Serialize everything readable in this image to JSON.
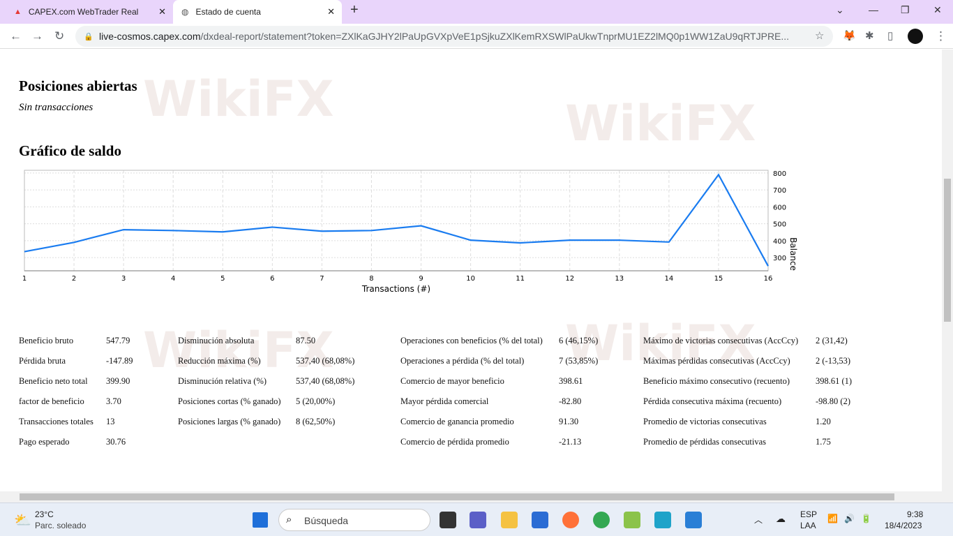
{
  "browser": {
    "tabs": [
      {
        "title": "CAPEX.com WebTrader Real",
        "active": false
      },
      {
        "title": "Estado de cuenta",
        "active": true
      }
    ],
    "url_host": "live-cosmos.capex.com",
    "url_path": "/dxdeal-report/statement?token=ZXlKaGJHY2lPaUpGVXpVeE1pSjkuZXlKemRXSWlPaUkwTnprMU1EZ2lMQ0p1WW1ZaU9qRTJPRE..."
  },
  "page": {
    "open_positions_title": "Posiciones abiertas",
    "no_transactions": "Sin transacciones",
    "chart_title": "Gráfico de saldo",
    "watermark": "WikiFX"
  },
  "chart_data": {
    "type": "line",
    "xlabel": "Transactions (#)",
    "ylabel": "Balance",
    "x": [
      1,
      2,
      3,
      4,
      5,
      6,
      7,
      8,
      9,
      10,
      11,
      12,
      13,
      14,
      15,
      16
    ],
    "values": [
      335,
      390,
      465,
      460,
      452,
      480,
      456,
      460,
      488,
      403,
      387,
      403,
      403,
      392,
      790,
      250
    ],
    "xlim": [
      1,
      16
    ],
    "ylim": [
      222,
      816
    ],
    "yticks": [
      300,
      400,
      500,
      600,
      700,
      800
    ],
    "grid": true,
    "color": "#1a7cf0"
  },
  "stats": [
    [
      {
        "l": "Beneficio bruto",
        "v": "547.79"
      },
      {
        "l": "Pérdida bruta",
        "v": "-147.89"
      },
      {
        "l": "Beneficio neto total",
        "v": "399.90"
      },
      {
        "l": "factor de beneficio",
        "v": "3.70"
      },
      {
        "l": "Transacciones totales",
        "v": "13"
      },
      {
        "l": "Pago esperado",
        "v": "30.76"
      }
    ],
    [
      {
        "l": "Disminución absoluta",
        "v": "87.50"
      },
      {
        "l": "Reducción máxima (%)",
        "v": "537,40 (68,08%)"
      },
      {
        "l": "Disminución relativa (%)",
        "v": "537,40 (68,08%)"
      },
      {
        "l": "Posiciones cortas (% ganado)",
        "v": "5 (20,00%)"
      },
      {
        "l": "Posiciones largas (% ganado)",
        "v": "8 (62,50%)"
      }
    ],
    [
      {
        "l": "Operaciones con beneficios (% del total)",
        "v": "6 (46,15%)"
      },
      {
        "l": "Operaciones a pérdida (% del total)",
        "v": "7 (53,85%)"
      },
      {
        "l": "Comercio de mayor beneficio",
        "v": "398.61"
      },
      {
        "l": "Mayor pérdida comercial",
        "v": "-82.80"
      },
      {
        "l": "Comercio de ganancia promedio",
        "v": "91.30"
      },
      {
        "l": "Comercio de pérdida promedio",
        "v": "-21.13"
      }
    ],
    [
      {
        "l": "Máximo de victorias consecutivas (AccCcy)",
        "v": "2 (31,42)"
      },
      {
        "l": "Máximas pérdidas consecutivas (AccCcy)",
        "v": "2 (-13,53)"
      },
      {
        "l": "Beneficio máximo consecutivo (recuento)",
        "v": "398.61 (1)"
      },
      {
        "l": "Pérdida consecutiva máxima (recuento)",
        "v": "-98.80 (2)"
      },
      {
        "l": "Promedio de victorias consecutivas",
        "v": "1.20"
      },
      {
        "l": "Promedio de pérdidas consecutivas",
        "v": "1.75"
      }
    ]
  ],
  "taskbar": {
    "temp": "23°C",
    "weather": "Parc. soleado",
    "search": "Búsqueda",
    "lang1": "ESP",
    "lang2": "LAA",
    "time": "9:38",
    "date": "18/4/2023"
  }
}
